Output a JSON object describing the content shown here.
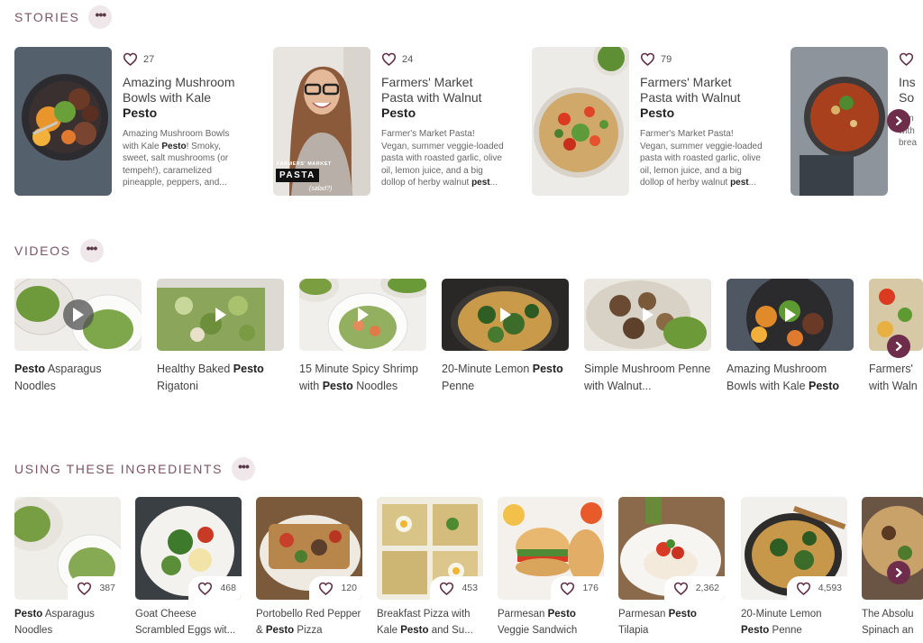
{
  "stories": {
    "title": "STORIES",
    "more": "•••",
    "items": [
      {
        "likes": "27",
        "title": "Amazing Mushroom Bowls with Kale ",
        "title_bold": "Pesto",
        "desc1": "Amazing Mushroom Bowls with Kale ",
        "desc_bold": "Pesto",
        "desc2": "! Smoky, sweet, salt mushrooms (or tempeh!), caramelized pineapple, peppers, and..."
      },
      {
        "likes": "24",
        "title": "Farmers' Market Pasta with Walnut ",
        "title_bold": "Pesto",
        "desc1": "Farmer's Market Pasta! Vegan, summer veggie-loaded pasta with roasted garlic, olive oil, lemon juice, and a big dollop of herby walnut ",
        "desc_bold": "pest",
        "desc2": "...",
        "badge1": "FARMERS' MARKET",
        "badge2": "PASTA",
        "badge3": "(salad?)"
      },
      {
        "likes": "79",
        "title": "Farmers' Market Pasta with Walnut ",
        "title_bold": "Pesto",
        "desc1": "Farmer's Market Pasta! Vegan, summer veggie-loaded pasta with roasted garlic, olive oil, lemon juice, and a big dollop of herby walnut ",
        "desc_bold": "pest",
        "desc2": "..."
      },
      {
        "title": "Ins So",
        "desc1": "tom with brea"
      }
    ]
  },
  "videos": {
    "title": "VIDEOS",
    "more": "•••",
    "items": [
      {
        "b": "Pesto",
        "t": " Asparagus Noodles",
        "pre": ""
      },
      {
        "pre": "Healthy Baked ",
        "b": "Pesto",
        "t": " Rigatoni"
      },
      {
        "pre": "15 Minute Spicy Shrimp with ",
        "b": "Pesto",
        "t": " Noodles"
      },
      {
        "pre": "20-Minute Lemon ",
        "b": "Pesto",
        "t": " Penne"
      },
      {
        "pre": "Simple Mushroom Penne with Walnut...",
        "b": "",
        "t": ""
      },
      {
        "pre": "Amazing Mushroom Bowls with Kale ",
        "b": "Pesto",
        "t": ""
      },
      {
        "pre": "Farmers' with Waln",
        "b": "",
        "t": ""
      }
    ]
  },
  "ingredients": {
    "title": "USING THESE INGREDIENTS",
    "more": "•••",
    "items": [
      {
        "likes": "387",
        "pre": "",
        "b": "Pesto",
        "t": " Asparagus Noodles"
      },
      {
        "likes": "468",
        "pre": "Goat Cheese Scrambled Eggs wit...",
        "b": "",
        "t": ""
      },
      {
        "likes": "120",
        "pre": "Portobello Red Pepper & ",
        "b": "Pesto",
        "t": " Pizza"
      },
      {
        "likes": "453",
        "pre": "Breakfast Pizza with Kale ",
        "b": "Pesto",
        "t": " and Su..."
      },
      {
        "likes": "176",
        "pre": "Parmesan ",
        "b": "Pesto",
        "t": " Veggie Sandwich"
      },
      {
        "likes": "2,362",
        "pre": "Parmesan ",
        "b": "Pesto",
        "t": " Tilapia"
      },
      {
        "likes": "4,593",
        "pre": "20-Minute Lemon ",
        "b": "Pesto",
        "t": " Penne"
      },
      {
        "likes": "",
        "pre": "The Absolu Spinach an",
        "b": "",
        "t": ""
      }
    ]
  },
  "colors": {
    "accent": "#6e2d4a",
    "heading": "#7a5566"
  }
}
